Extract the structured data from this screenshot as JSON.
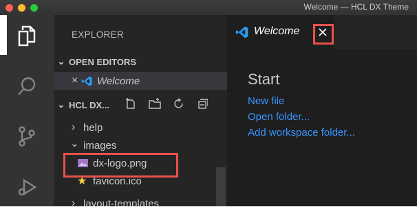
{
  "window": {
    "title": "Welcome — HCL DX Theme"
  },
  "explorer": {
    "title": "EXPLORER",
    "open_editors": {
      "header": "OPEN EDITORS",
      "item": {
        "close_glyph": "×",
        "label": "Welcome"
      }
    },
    "project": {
      "header": "HCL DX...",
      "items": [
        {
          "label": "help",
          "chevron": "›"
        },
        {
          "label": "images",
          "chevron": "⌄"
        },
        {
          "label": "dx-logo.png"
        },
        {
          "label": "favicon.ico",
          "icon": "star-icon"
        },
        {
          "label": "layout-templates",
          "chevron": "›"
        }
      ]
    }
  },
  "editor": {
    "tab": {
      "label": "Welcome",
      "close_glyph": "✕"
    },
    "welcome": {
      "start_title": "Start",
      "links": [
        "New file",
        "Open folder...",
        "Add workspace folder..."
      ]
    }
  },
  "colors": {
    "accent_blue": "#3794ff",
    "highlight_red": "#e8524a",
    "sidebar_bg": "#252526",
    "activitybar_bg": "#333333",
    "editor_bg": "#1e1e1e"
  }
}
